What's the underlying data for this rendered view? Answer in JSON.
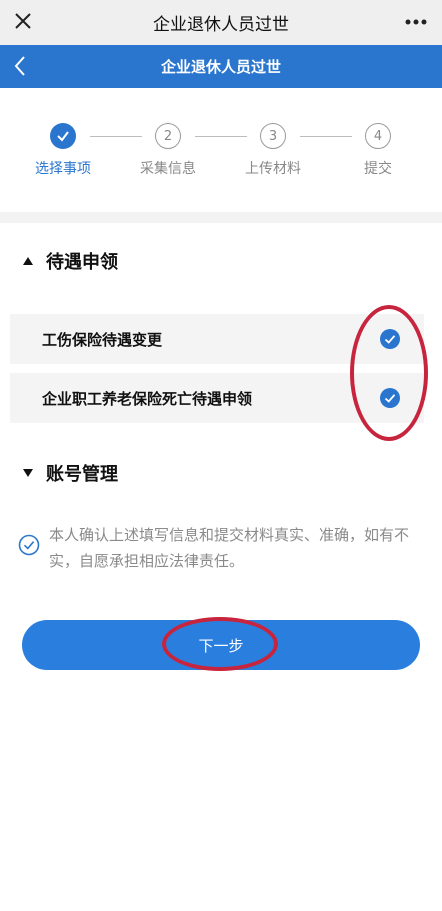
{
  "topbar": {
    "title": "企业退休人员过世"
  },
  "navbar": {
    "title": "企业退休人员过世"
  },
  "steps": [
    {
      "number": "",
      "label": "选择事项",
      "state": "done"
    },
    {
      "number": "2",
      "label": "采集信息",
      "state": "pending"
    },
    {
      "number": "3",
      "label": "上传材料",
      "state": "pending"
    },
    {
      "number": "4",
      "label": "提交",
      "state": "pending"
    }
  ],
  "sections": {
    "benefits": {
      "title": "待遇申领",
      "expanded": true,
      "options": [
        {
          "label": "工伤保险待遇变更",
          "checked": true
        },
        {
          "label": "企业职工养老保险死亡待遇申领",
          "checked": true
        }
      ]
    },
    "account": {
      "title": "账号管理",
      "expanded": false
    }
  },
  "agreement": {
    "checked": true,
    "text": "本人确认上述填写信息和提交材料真实、准确，如有不实，自愿承担相应法律责任。"
  },
  "next_button": {
    "label": "下一步"
  },
  "colors": {
    "primary": "#2a76cf",
    "button": "#2a7fde",
    "annotation": "#c7253e"
  }
}
